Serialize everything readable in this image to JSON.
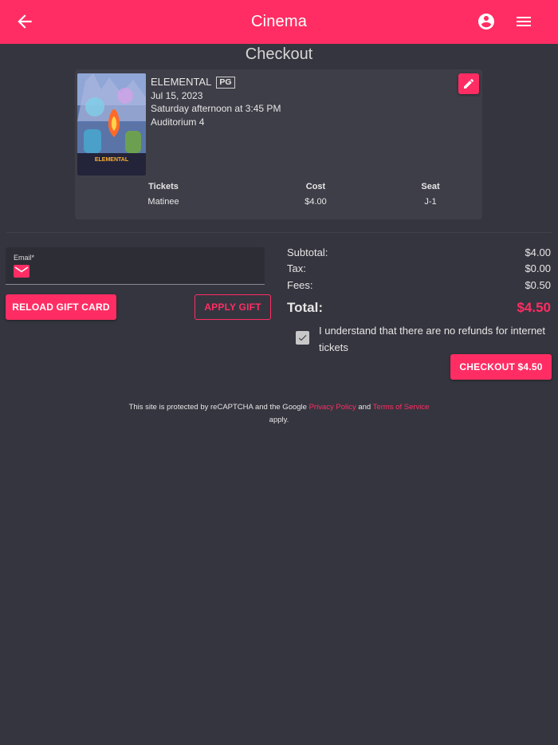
{
  "app": {
    "title": "Cinema",
    "accent_color": "#ff2d63",
    "background_color": "#35353f"
  },
  "page": {
    "title": "Checkout"
  },
  "movie": {
    "title": "ELEMENTAL",
    "rating": "PG",
    "date": "Jul 15, 2023",
    "showtime": "Saturday afternoon at 3:45 PM",
    "auditorium": "Auditorium 4",
    "poster_text": "ELEMENTAL"
  },
  "tickets": {
    "headers": [
      "Tickets",
      "Cost",
      "Seat"
    ],
    "rows": [
      {
        "type": "Matinee",
        "cost": "$4.00",
        "seat": "J-1"
      }
    ]
  },
  "email": {
    "label": "Email*",
    "value": ""
  },
  "buttons": {
    "reload_gift_card": "RELOAD GIFT CARD",
    "apply_gift": "APPLY GIFT",
    "checkout": "CHECKOUT $4.50"
  },
  "summary": {
    "subtotal_label": "Subtotal:",
    "subtotal_value": "$4.00",
    "tax_label": "Tax:",
    "tax_value": "$0.00",
    "fees_label": "Fees:",
    "fees_value": "$0.50",
    "total_label": "Total:",
    "total_value": "$4.50"
  },
  "agreement": {
    "text": "I understand that there are no refunds for internet tickets",
    "checked": true
  },
  "recaptcha": {
    "prefix": "This site is protected by reCAPTCHA and the Google",
    "privacy_link": "Privacy Policy",
    "and": "and",
    "terms_link": "Terms of Service",
    "suffix": "apply."
  },
  "icons": {
    "back": "arrow-left-icon",
    "account": "account-circle-icon",
    "menu": "hamburger-menu-icon",
    "edit": "pencil-icon",
    "email": "envelope-icon",
    "check": "checkmark-icon"
  }
}
